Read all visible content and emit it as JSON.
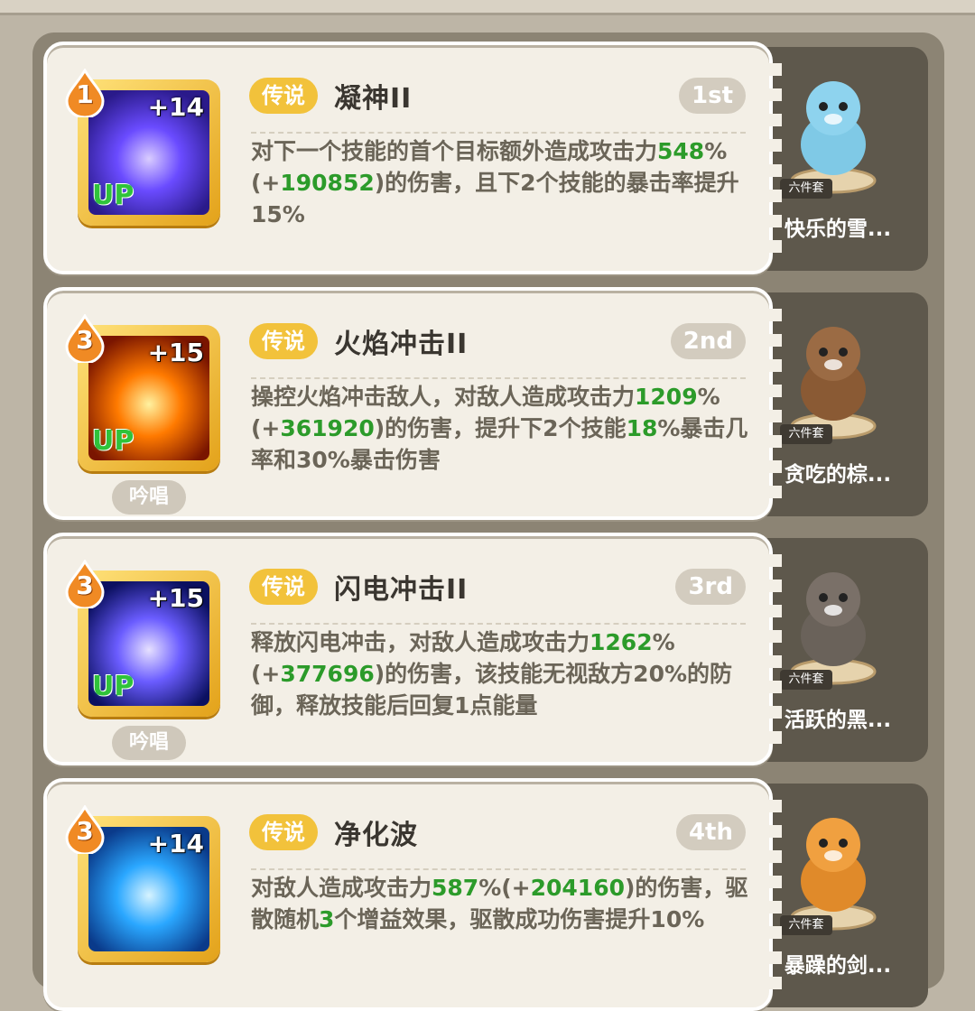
{
  "skills": [
    {
      "order": "1",
      "plus": "+14",
      "up": "UP",
      "rarity": "传说",
      "name": "凝神II",
      "rank": "1st",
      "chant": "",
      "desc": [
        {
          "t": "对下一个技能的首个目标额外造成攻击力"
        },
        {
          "t": "548",
          "g": true
        },
        {
          "t": "%(+"
        },
        {
          "t": "190852",
          "g": true
        },
        {
          "t": ")的伤害，且下2个技能的暴击率提升15%"
        }
      ],
      "set": "六件套",
      "pet": "快乐的雪...",
      "colors": [
        "#2a1a8a",
        "#6a4bff",
        "#d9ccff"
      ]
    },
    {
      "order": "3",
      "plus": "+15",
      "up": "UP",
      "rarity": "传说",
      "name": "火焰冲击II",
      "rank": "2nd",
      "chant": "吟唱",
      "desc": [
        {
          "t": "操控火焰冲击敌人，对敌人造成攻击力"
        },
        {
          "t": "1209",
          "g": true
        },
        {
          "t": "%(+"
        },
        {
          "t": "361920",
          "g": true
        },
        {
          "t": ")的伤害，提升下2个技能"
        },
        {
          "t": "18",
          "g": true
        },
        {
          "t": "%暴击几率和30%暴击伤害"
        }
      ],
      "set": "六件套",
      "pet": "贪吃的棕...",
      "colors": [
        "#7a1500",
        "#ff7a00",
        "#fff2a0"
      ]
    },
    {
      "order": "3",
      "plus": "+15",
      "up": "UP",
      "rarity": "传说",
      "name": "闪电冲击II",
      "rank": "3rd",
      "chant": "吟唱",
      "desc": [
        {
          "t": "释放闪电冲击，对敌人造成攻击力"
        },
        {
          "t": "1262",
          "g": true
        },
        {
          "t": "%(+"
        },
        {
          "t": "377696",
          "g": true
        },
        {
          "t": ")的伤害，该技能无视敌方20%的防御，释放技能后回复1点能量"
        }
      ],
      "set": "六件套",
      "pet": "活跃的黑...",
      "colors": [
        "#0b1060",
        "#6a5cff",
        "#e6e0ff"
      ]
    },
    {
      "order": "3",
      "plus": "+14",
      "up": "",
      "rarity": "传说",
      "name": "净化波",
      "rank": "4th",
      "chant": "",
      "desc": [
        {
          "t": "对敌人造成攻击力"
        },
        {
          "t": "587",
          "g": true
        },
        {
          "t": "%(+"
        },
        {
          "t": "204160",
          "g": true
        },
        {
          "t": ")的伤害，驱散随机"
        },
        {
          "t": "3",
          "g": true
        },
        {
          "t": "个增益效果，驱散成功伤害提升10%"
        }
      ],
      "set": "六件套",
      "pet": "暴躁的剑...",
      "colors": [
        "#0a3a8a",
        "#2aa7ff",
        "#d6f3ff"
      ]
    }
  ]
}
